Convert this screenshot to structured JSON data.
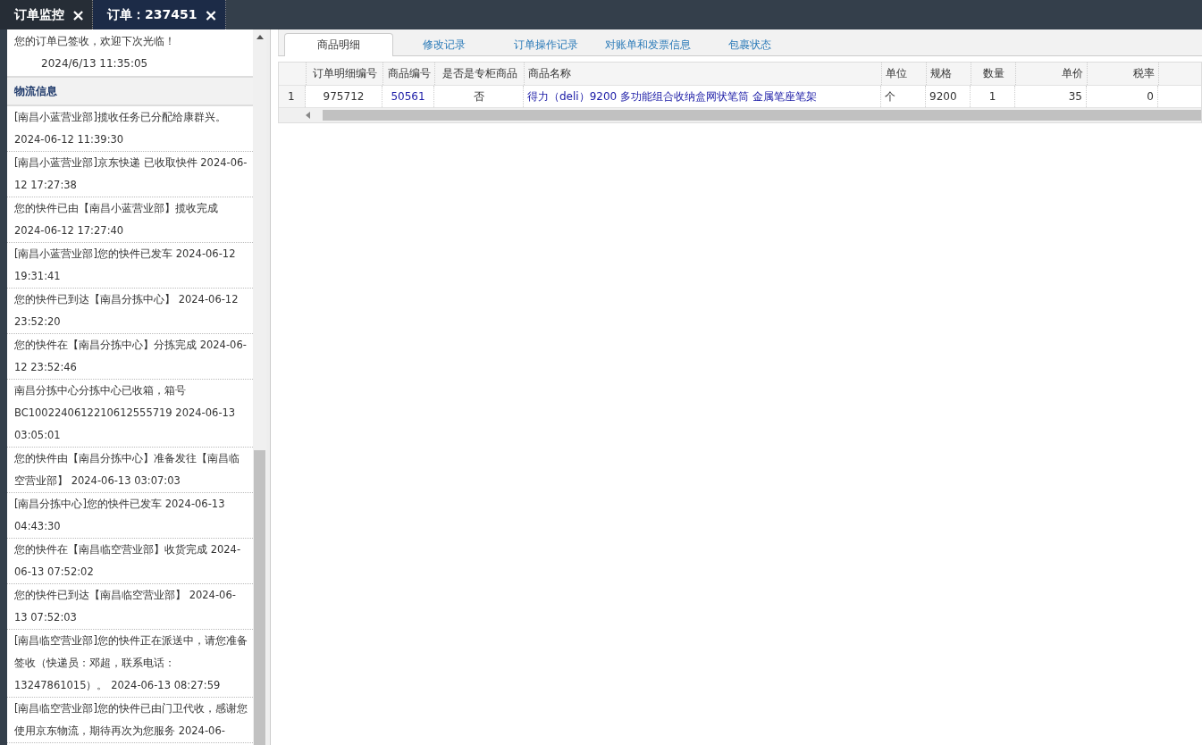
{
  "window_tabs": [
    {
      "label": "订单监控",
      "selected": false,
      "close": "×"
    },
    {
      "label": "订单：237451",
      "selected": true,
      "close": "×"
    }
  ],
  "sign_notice": {
    "message": "您的订单已签收，欢迎下次光临！",
    "time": "2024/6/13 11:35:05"
  },
  "logistics": {
    "title": "物流信息",
    "entries": [
      "[南昌小蓝营业部]揽收任务已分配给康群兴。 2024-06-12 11:39:30",
      "[南昌小蓝营业部]京东快递 已收取快件 2024-06-12 17:27:38",
      "您的快件已由【南昌小蓝营业部】揽收完成 2024-06-12 17:27:40",
      "[南昌小蓝营业部]您的快件已发车 2024-06-12 19:31:41",
      "您的快件已到达【南昌分拣中心】 2024-06-12 23:52:20",
      "您的快件在【南昌分拣中心】分拣完成 2024-06-12 23:52:46",
      "南昌分拣中心分拣中心已收箱，箱号 BC1002240612210612555719 2024-06-13 03:05:01",
      "您的快件由【南昌分拣中心】准备发往【南昌临空营业部】 2024-06-13 03:07:03",
      "[南昌分拣中心]您的快件已发车 2024-06-13 04:43:30",
      "您的快件在【南昌临空营业部】收货完成 2024-06-13 07:52:02",
      "您的快件已到达【南昌临空营业部】 2024-06-13 07:52:03",
      "[南昌临空营业部]您的快件正在派送中，请您准备签收（快递员：邓超，联系电话：13247861015）。 2024-06-13 08:27:59",
      "[南昌临空营业部]您的快件已由门卫代收，感谢您使用京东物流，期待再次为您服务 2024-06-"
    ]
  },
  "detail_tabs": [
    {
      "label": "商品明细",
      "selected": true
    },
    {
      "label": "修改记录",
      "selected": false
    },
    {
      "label": "订单操作记录",
      "selected": false
    },
    {
      "label": "对账单和发票信息",
      "selected": false
    },
    {
      "label": "包裹状态",
      "selected": false
    }
  ],
  "table": {
    "columns": [
      "订单明细编号",
      "商品编号",
      "是否是专柜商品",
      "商品名称",
      "单位",
      "规格",
      "数量",
      "单价",
      "税率"
    ],
    "rows": [
      {
        "number": "1",
        "cells": [
          "975712",
          "50561",
          "否",
          "得力（deli）9200 多功能组合收纳盒网状笔筒 金属笔座笔架",
          "个",
          "9200",
          "1",
          "35",
          "0"
        ]
      }
    ]
  }
}
